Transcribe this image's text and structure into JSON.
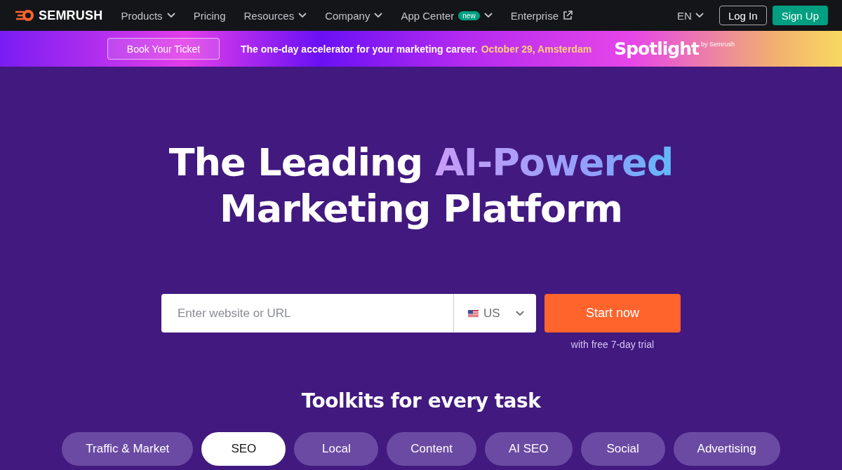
{
  "nav": {
    "logo": "SEMRUSH",
    "items": [
      {
        "label": "Products",
        "kind": "dropdown"
      },
      {
        "label": "Pricing",
        "kind": "plain"
      },
      {
        "label": "Resources",
        "kind": "dropdown"
      },
      {
        "label": "Company",
        "kind": "dropdown"
      },
      {
        "label": "App Center",
        "kind": "dropdown",
        "badge": "new"
      },
      {
        "label": "Enterprise",
        "kind": "external"
      }
    ],
    "language": "EN",
    "login": "Log In",
    "signup": "Sign Up"
  },
  "promo": {
    "button": "Book Your Ticket",
    "text": "The one-day accelerator for your marketing career.",
    "date": "October 29, Amsterdam",
    "brand": "Spotlight",
    "brand_by": "by Semrush"
  },
  "hero": {
    "title_start": "The Leading",
    "title_highlight": "AI-Powered",
    "title_end": "Marketing Platform",
    "search": {
      "placeholder": "Enter website or URL",
      "country": "US"
    },
    "cta": "Start now",
    "cta_note": "with free 7-day trial"
  },
  "toolkits": {
    "heading": "Toolkits for every task",
    "tabs": [
      {
        "label": "Traffic & Market",
        "selected": false
      },
      {
        "label": "SEO",
        "selected": true
      },
      {
        "label": "Local",
        "selected": false
      },
      {
        "label": "Content",
        "selected": false
      },
      {
        "label": "AI SEO",
        "selected": false
      },
      {
        "label": "Social",
        "selected": false
      },
      {
        "label": "Advertising",
        "selected": false
      }
    ]
  }
}
